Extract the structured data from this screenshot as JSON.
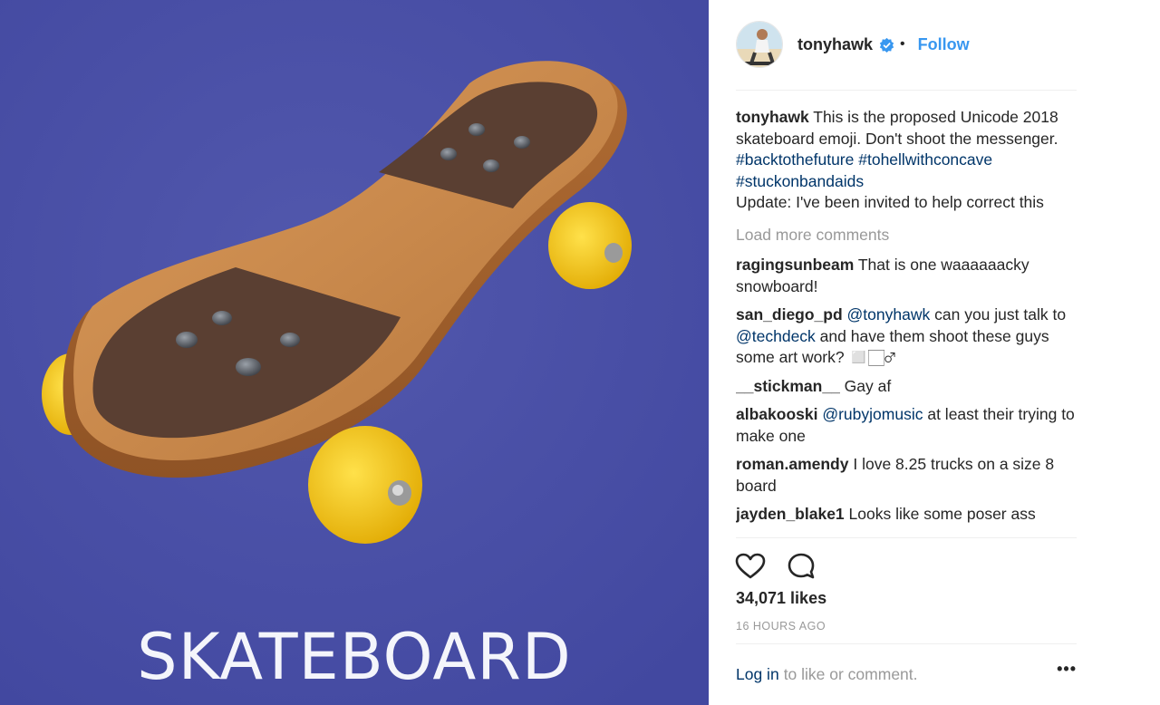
{
  "post": {
    "image_caption_text": "SKATEBOARD",
    "author": "tonyhawk",
    "follow_label": "Follow",
    "separator": "•",
    "caption": {
      "username": "tonyhawk",
      "text_1": " This is the proposed Unicode 2018 skateboard emoji. Don't shoot the messenger. ",
      "hashtag_1": "#backtothefuture",
      "hashtag_2": "#tohellwithconcave",
      "hashtag_3": "#stuckonbandaids",
      "text_2": "Update: I've been invited to help correct this"
    },
    "load_more_label": "Load more comments",
    "likes": "34,071 likes",
    "timestamp": "16 HOURS AGO",
    "login_link": "Log in",
    "login_rest": "to like or comment.",
    "more_label": "•••"
  },
  "comments": [
    {
      "user": "ragingsunbeam",
      "text": " That is one waaaaaacky snowboard!"
    },
    {
      "user": "san_diego_pd",
      "mention_1": "@tonyhawk",
      "text_1": " can you just talk to ",
      "mention_2": "@techdeck",
      "text_2": " and have them shoot these guys some art work? ◻️🏻‍♂"
    },
    {
      "user": "__stickman__",
      "text": " Gay af"
    },
    {
      "user": "albakooski",
      "mention": "@rubyjomusic",
      "text": " at least their trying to make one"
    },
    {
      "user": "roman.amendy",
      "text": " I love 8.25 trucks on a size 8 board"
    },
    {
      "user": "jayden_blake1",
      "text": " Looks like some poser ass"
    }
  ],
  "icons": {
    "verified": "verified-badge-icon",
    "like": "heart-icon",
    "comment": "comment-bubble-icon",
    "avatar": "profile-photo"
  },
  "colors": {
    "image_background": "#4a50a0",
    "link_blue": "#3897f0",
    "hashtag_blue": "#003569",
    "muted_gray": "#999999",
    "wheel_yellow": "#f2c10c",
    "deck_wood": "#c68a4c",
    "grip_brown": "#5a3f32"
  }
}
